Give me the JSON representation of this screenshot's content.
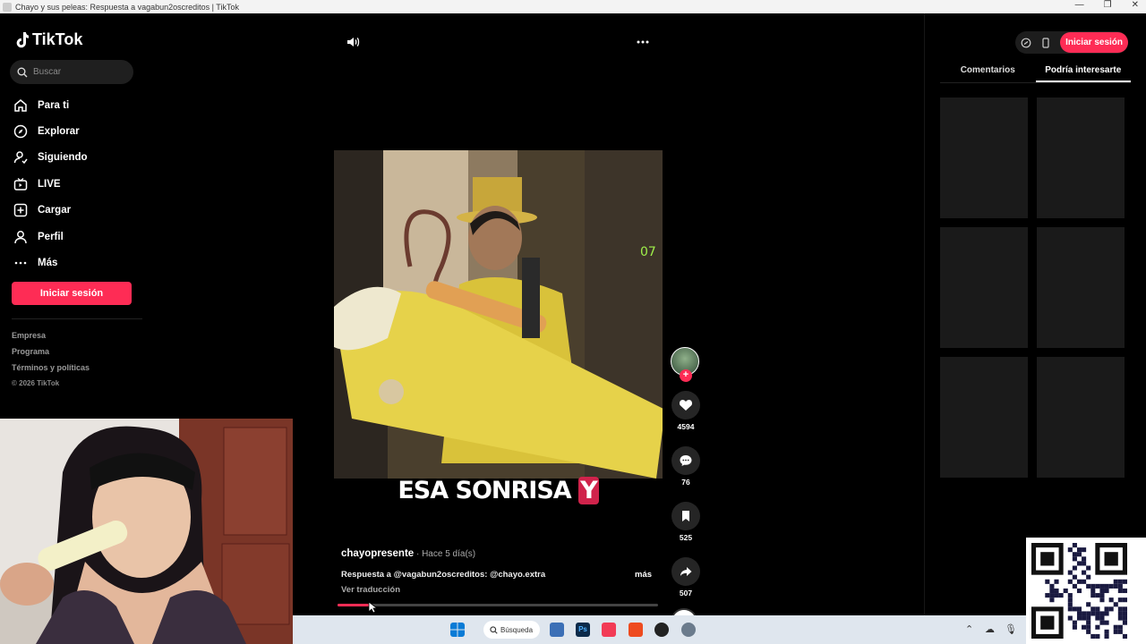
{
  "window": {
    "title": "Chayo y sus peleas: Respuesta a vagabun2oscreditos | TikTok"
  },
  "sidebar": {
    "logo": "TikTok",
    "search_placeholder": "Buscar",
    "items": [
      {
        "label": "Para ti",
        "icon": "home-icon"
      },
      {
        "label": "Explorar",
        "icon": "compass-icon"
      },
      {
        "label": "Siguiendo",
        "icon": "following-icon"
      },
      {
        "label": "LIVE",
        "icon": "live-icon"
      },
      {
        "label": "Cargar",
        "icon": "upload-icon"
      },
      {
        "label": "Perfil",
        "icon": "profile-icon"
      },
      {
        "label": "Más",
        "icon": "more-icon"
      }
    ],
    "login_button": "Iniciar sesión",
    "footer": [
      "Empresa",
      "Programa",
      "Términos y políticas"
    ],
    "copyright": "© 2026 TikTok"
  },
  "video": {
    "caption_main": "ESA SONRISA ",
    "caption_highlight": "Y",
    "overlay_number": "07",
    "author": "chayopresente",
    "time": " · Hace 5 día(s)",
    "description": "Respuesta a @vagabun2oscreditos: @chayo.extra",
    "more_label": "más",
    "translate_label": "Ver traducción",
    "progress": 0.1
  },
  "actions": {
    "likes": "4594",
    "comments": "76",
    "saves": "525",
    "shares": "507"
  },
  "right_panel": {
    "login_button": "Iniciar sesión",
    "tabs": [
      "Comentarios",
      "Podría interesarte"
    ],
    "active_tab": 1
  },
  "taskbar": {
    "search_label": "Búsqueda"
  },
  "colors": {
    "accent": "#fe2c55"
  }
}
